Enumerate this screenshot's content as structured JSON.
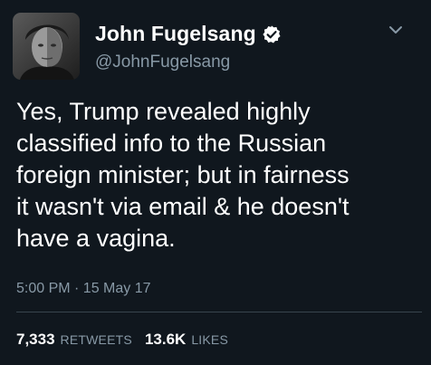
{
  "author": {
    "display_name": "John Fugelsang",
    "handle": "@JohnFugelsang",
    "verified": true,
    "avatar_icon": "profile-photo"
  },
  "tweet": {
    "lines": [
      "Yes, Trump revealed highly",
      "classified info to the Russian",
      "foreign minister; but in fairness",
      "it wasn't via email & he doesn't",
      "have a vagina."
    ],
    "timestamp": "5:00 PM · 15 May 17"
  },
  "stats": {
    "retweets_count": "7,333",
    "retweets_label": "RETWEETS",
    "likes_count": "13.6K",
    "likes_label": "LIKES"
  },
  "colors": {
    "background": "#10171e",
    "text_primary": "#ffffff",
    "text_secondary": "#8899a6",
    "divider": "#38444d"
  }
}
